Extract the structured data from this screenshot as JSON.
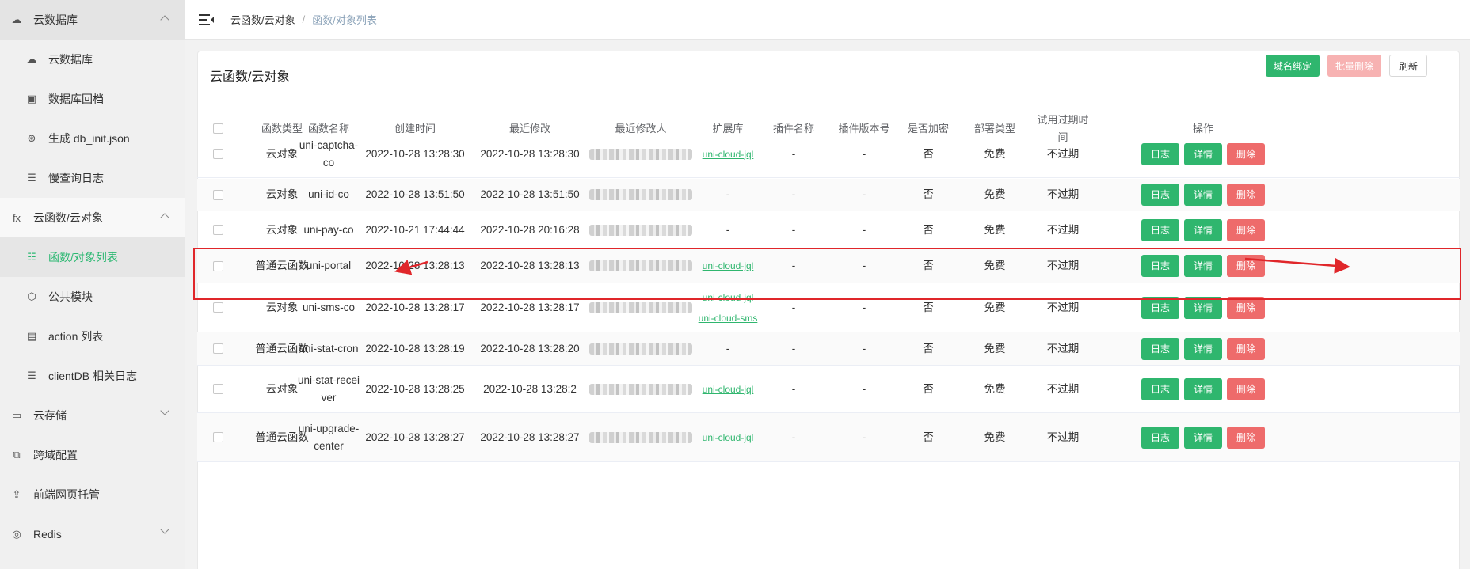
{
  "sidebar": {
    "items": [
      {
        "label": "云数据库",
        "icon": "cloud-db-icon",
        "level": "top",
        "chevron": "up"
      },
      {
        "label": "云数据库",
        "icon": "cloud-db-icon",
        "level": "sub"
      },
      {
        "label": "数据库回档",
        "icon": "backup-icon",
        "level": "sub"
      },
      {
        "label": "生成 db_init.json",
        "icon": "generate-icon",
        "level": "sub"
      },
      {
        "label": "慢查询日志",
        "icon": "log-icon",
        "level": "sub"
      },
      {
        "label": "云函数/云对象",
        "icon": "fx-icon",
        "level": "top",
        "chevron": "up"
      },
      {
        "label": "函数/对象列表",
        "icon": "list-icon",
        "level": "sub",
        "active": true
      },
      {
        "label": "公共模块",
        "icon": "module-icon",
        "level": "sub"
      },
      {
        "label": "action 列表",
        "icon": "action-icon",
        "level": "sub"
      },
      {
        "label": "clientDB 相关日志",
        "icon": "log-icon",
        "level": "sub"
      },
      {
        "label": "云存储",
        "icon": "storage-icon",
        "level": "top",
        "chevron": "down"
      },
      {
        "label": "跨域配置",
        "icon": "cors-icon",
        "level": "top"
      },
      {
        "label": "前端网页托管",
        "icon": "hosting-icon",
        "level": "top"
      },
      {
        "label": "Redis",
        "icon": "redis-icon",
        "level": "top",
        "chevron": "down"
      }
    ]
  },
  "header": {
    "breadcrumb": [
      "云函数/云对象",
      "函数/对象列表"
    ]
  },
  "card": {
    "title": "云函数/云对象",
    "buttons": {
      "bind_domain": "域名绑定",
      "batch_delete": "批量删除",
      "refresh": "刷新"
    }
  },
  "table": {
    "columns": [
      "函数类型",
      "函数名称",
      "创建时间",
      "最近修改",
      "最近修改人",
      "扩展库",
      "插件名称",
      "插件版本号",
      "是否加密",
      "部署类型",
      "试用过期时间",
      "操作"
    ],
    "op_labels": {
      "log": "日志",
      "detail": "详情",
      "delete": "删除"
    },
    "rows": [
      {
        "type": "云对象",
        "name": "uni-captcha-co",
        "created": "2022-10-28 13:28:30",
        "modified": "2022-10-28 13:28:30",
        "libs": [
          "uni-cloud-jql"
        ],
        "plugin": "-",
        "version": "-",
        "encrypted": "否",
        "deploy": "免费",
        "expire": "不过期"
      },
      {
        "type": "云对象",
        "name": "uni-id-co",
        "created": "2022-10-28 13:51:50",
        "modified": "2022-10-28 13:51:50",
        "libs": [],
        "lib_text": "-",
        "plugin": "-",
        "version": "-",
        "encrypted": "否",
        "deploy": "免费",
        "expire": "不过期"
      },
      {
        "type": "云对象",
        "name": "uni-pay-co",
        "created": "2022-10-21 17:44:44",
        "modified": "2022-10-28 20:16:28",
        "libs": [],
        "lib_text": "-",
        "plugin": "-",
        "version": "-",
        "encrypted": "否",
        "deploy": "免费",
        "expire": "不过期"
      },
      {
        "type": "普通云函数",
        "name": "uni-portal",
        "created": "2022-10-28 13:28:13",
        "modified": "2022-10-28 13:28:13",
        "libs": [
          "uni-cloud-jql"
        ],
        "plugin": "-",
        "version": "-",
        "encrypted": "否",
        "deploy": "免费",
        "expire": "不过期"
      },
      {
        "type": "云对象",
        "name": "uni-sms-co",
        "created": "2022-10-28 13:28:17",
        "modified": "2022-10-28 13:28:17",
        "libs": [
          "uni-cloud-jql",
          "uni-cloud-sms"
        ],
        "plugin": "-",
        "version": "-",
        "encrypted": "否",
        "deploy": "免费",
        "expire": "不过期"
      },
      {
        "type": "普通云函数",
        "name": "uni-stat-cron",
        "created": "2022-10-28 13:28:19",
        "modified": "2022-10-28 13:28:20",
        "libs": [],
        "lib_text": "-",
        "plugin": "-",
        "version": "-",
        "encrypted": "否",
        "deploy": "免费",
        "expire": "不过期"
      },
      {
        "type": "云对象",
        "name": "uni-stat-receiver",
        "created": "2022-10-28 13:28:25",
        "modified": "2022-10-28 13:28:2",
        "libs": [
          "uni-cloud-jql"
        ],
        "plugin": "-",
        "version": "-",
        "encrypted": "否",
        "deploy": "免费",
        "expire": "不过期"
      },
      {
        "type": "普通云函数",
        "name": "uni-upgrade-center",
        "created": "2022-10-28 13:28:27",
        "modified": "2022-10-28 13:28:27",
        "libs": [
          "uni-cloud-jql"
        ],
        "plugin": "-",
        "version": "-",
        "encrypted": "否",
        "deploy": "免费",
        "expire": "不过期"
      }
    ]
  },
  "colors": {
    "accent": "#2fb66e",
    "danger": "#ee6b6b",
    "annotation": "#e0262a"
  }
}
